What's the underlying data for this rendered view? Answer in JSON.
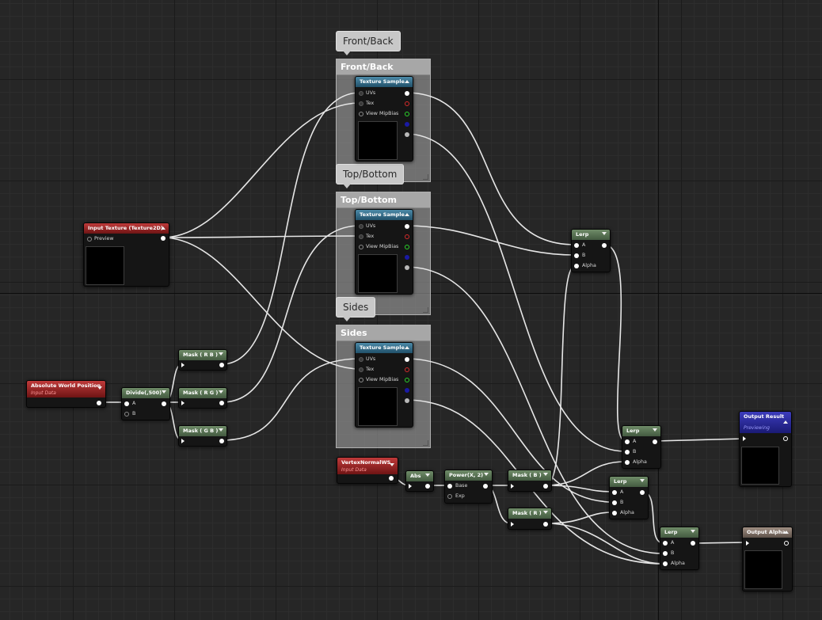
{
  "comments": [
    {
      "bubble": "Front/Back",
      "header": "Front/Back"
    },
    {
      "bubble": "Top/Bottom",
      "header": "Top/Bottom"
    },
    {
      "bubble": "Sides",
      "header": "Sides"
    }
  ],
  "texture_sample": {
    "title": "Texture Sample",
    "inputs": [
      "UVs",
      "Tex",
      "View MipBias"
    ]
  },
  "input_texture": {
    "title": "Input Texture (Texture2D)",
    "pin": "Preview"
  },
  "world_position": {
    "title": "Absolute World Position",
    "subtitle": "Input Data"
  },
  "divide": {
    "title": "Divide(,500)",
    "pins": [
      "A",
      "B"
    ]
  },
  "masks": {
    "rb": "Mask ( R B )",
    "rg": "Mask ( R G )",
    "gb": "Mask ( G B )",
    "b": "Mask ( B )",
    "r": "Mask ( R )"
  },
  "vertex_normal": {
    "title": "VertexNormalWS",
    "subtitle": "Input Data"
  },
  "abs": {
    "title": "Abs"
  },
  "power": {
    "title": "Power(X, 2)",
    "pins": [
      "Base",
      "Exp"
    ]
  },
  "lerp": {
    "title": "Lerp",
    "pins": [
      "A",
      "B",
      "Alpha"
    ]
  },
  "output_result": {
    "title": "Output Result",
    "subtitle": "Previewing"
  },
  "output_alpha": {
    "title": "Output Alpha"
  },
  "colors": {
    "grid_bg": "#262626",
    "wire": "#e6e6e6",
    "node_green": "#56704f",
    "node_blue": "#2f6a88",
    "node_red": "#9a2626",
    "node_purple": "#2a2a9c",
    "node_tan": "#7f7065",
    "comment": "#9e9e9e"
  }
}
